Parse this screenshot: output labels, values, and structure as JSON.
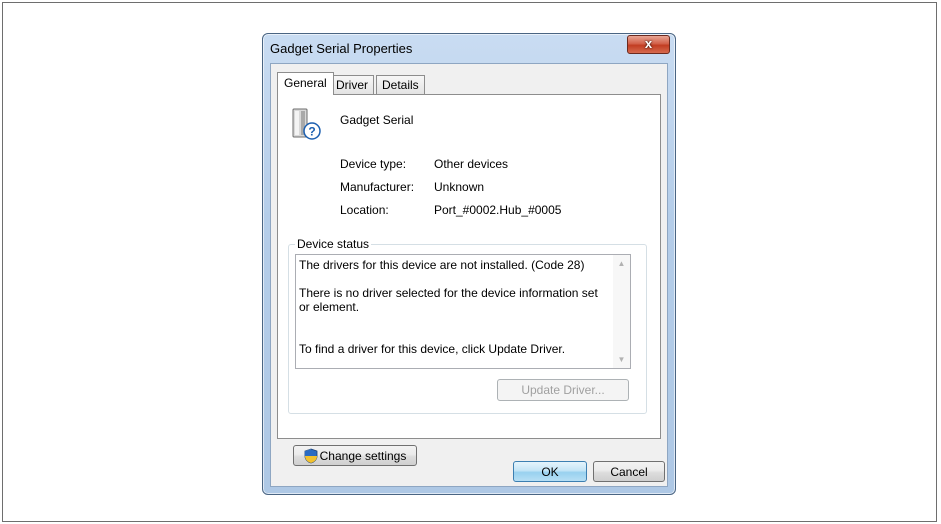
{
  "window": {
    "title": "Gadget Serial Properties",
    "close_label": "x"
  },
  "tabs": [
    "General",
    "Driver",
    "Details"
  ],
  "device": {
    "name": "Gadget Serial",
    "icon": "unknown-device-icon"
  },
  "properties": {
    "type_label": "Device type:",
    "type_value": "Other devices",
    "manufacturer_label": "Manufacturer:",
    "manufacturer_value": "Unknown",
    "location_label": "Location:",
    "location_value": "Port_#0002.Hub_#0005"
  },
  "status": {
    "group_label": "Device status",
    "lines": [
      "The drivers for this device are not installed. (Code 28)",
      "There is no driver selected for the device information set or element.",
      "To find a driver for this device, click Update Driver."
    ],
    "update_driver_label": "Update Driver..."
  },
  "buttons": {
    "change_settings_label": "Change settings",
    "ok_label": "OK",
    "cancel_label": "Cancel"
  },
  "colors": {
    "title_bar": "#b9d1ea",
    "close_button": "#c94a30",
    "default_button_border": "#3c7fb1"
  }
}
